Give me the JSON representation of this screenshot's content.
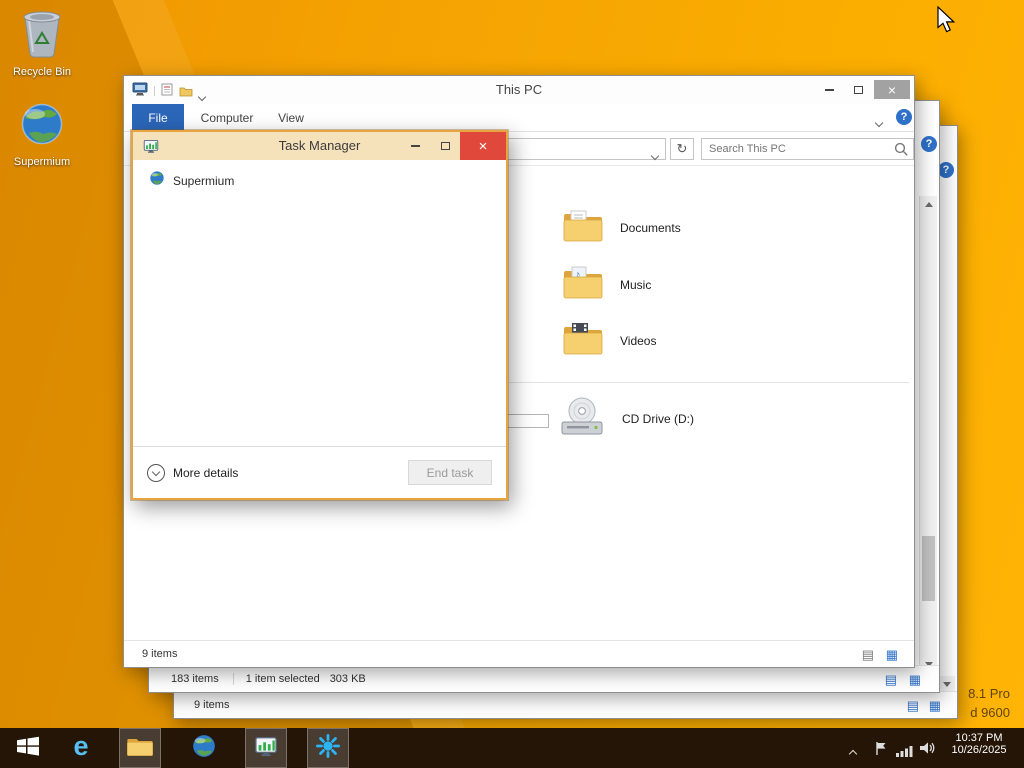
{
  "glyphs": {
    "close": "×",
    "question": "?",
    "refresh": "↻",
    "list_icon": "▤",
    "grid_icon": "▦",
    "note": "♪"
  },
  "desktop": {
    "recycle_bin_label": "Recycle Bin",
    "supermium_label": "Supermium",
    "watermark_line1": "8.1 Pro",
    "watermark_line2": "d 9600"
  },
  "explorer": {
    "title": "This PC",
    "tabs": [
      {
        "label": "File"
      },
      {
        "label": "Computer"
      },
      {
        "label": "View"
      }
    ],
    "search_placeholder": "Search This PC",
    "items": [
      {
        "label": "Documents"
      },
      {
        "label": "Music"
      },
      {
        "label": "Videos"
      },
      {
        "label": "CD Drive (D:)"
      }
    ],
    "partial_text": "9",
    "status_items": "9 items"
  },
  "task_manager": {
    "title": "Task Manager",
    "processes": [
      {
        "name": "Supermium"
      }
    ],
    "more_details_label": "More details",
    "end_task_label": "End task"
  },
  "bg_windows": {
    "a_status_items": "183 items",
    "a_status_selected": "1 item selected",
    "a_status_size": "303 KB",
    "b_status_items": "9 items"
  },
  "taskbar": {
    "clock_time": "10:37 PM",
    "clock_date": "10/26/2025"
  }
}
